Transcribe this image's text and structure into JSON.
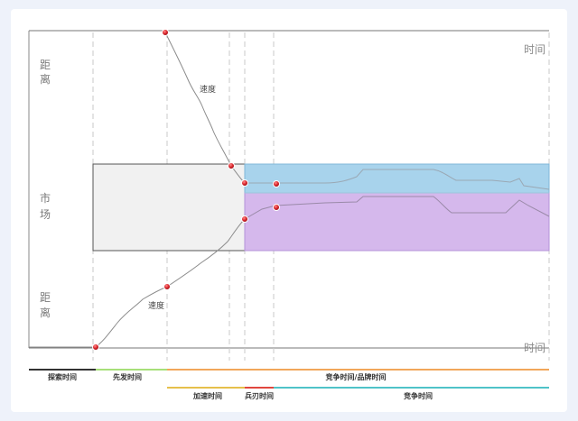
{
  "axes": {
    "top_right": "时间",
    "bottom_right": "时间",
    "left_top": [
      "距",
      "离"
    ],
    "left_middle": [
      "市",
      "场"
    ],
    "left_bottom": [
      "距",
      "离"
    ]
  },
  "curves": {
    "upper_label": "速度",
    "lower_label": "速度"
  },
  "timeline_row1": {
    "segments": [
      {
        "label": "探索时间",
        "color": "#333333"
      },
      {
        "label": "先发时间",
        "color": "#a7e07a"
      },
      {
        "label": "竞争时间/品牌时间",
        "color": "#f2a65a"
      }
    ]
  },
  "timeline_row2": {
    "segments": [
      {
        "label": "加速时间",
        "color": "#e6c04b"
      },
      {
        "label": "兵刃时间",
        "color": "#e0473e"
      },
      {
        "label": "竞争时间",
        "color": "#4fc3c8"
      }
    ]
  },
  "colors": {
    "market_box": "#f1f1f1",
    "blue_zone": "#a8d3ec",
    "purple_zone": "#d5b8ec",
    "point": "#d9242b"
  }
}
